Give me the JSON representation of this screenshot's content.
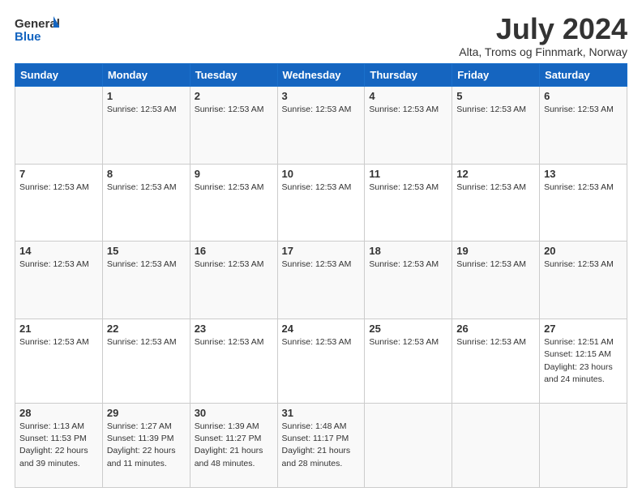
{
  "header": {
    "logo_line1": "General",
    "logo_line2": "Blue",
    "month_title": "July 2024",
    "location": "Alta, Troms og Finnmark, Norway"
  },
  "days_of_week": [
    "Sunday",
    "Monday",
    "Tuesday",
    "Wednesday",
    "Thursday",
    "Friday",
    "Saturday"
  ],
  "weeks": [
    [
      {
        "day": "",
        "info": ""
      },
      {
        "day": "1",
        "info": "Sunrise: 12:53 AM"
      },
      {
        "day": "2",
        "info": "Sunrise: 12:53 AM"
      },
      {
        "day": "3",
        "info": "Sunrise: 12:53 AM"
      },
      {
        "day": "4",
        "info": "Sunrise: 12:53 AM"
      },
      {
        "day": "5",
        "info": "Sunrise: 12:53 AM"
      },
      {
        "day": "6",
        "info": "Sunrise: 12:53 AM"
      }
    ],
    [
      {
        "day": "7",
        "info": "Sunrise: 12:53 AM"
      },
      {
        "day": "8",
        "info": "Sunrise: 12:53 AM"
      },
      {
        "day": "9",
        "info": "Sunrise: 12:53 AM"
      },
      {
        "day": "10",
        "info": "Sunrise: 12:53 AM"
      },
      {
        "day": "11",
        "info": "Sunrise: 12:53 AM"
      },
      {
        "day": "12",
        "info": "Sunrise: 12:53 AM"
      },
      {
        "day": "13",
        "info": "Sunrise: 12:53 AM"
      }
    ],
    [
      {
        "day": "14",
        "info": "Sunrise: 12:53 AM"
      },
      {
        "day": "15",
        "info": "Sunrise: 12:53 AM"
      },
      {
        "day": "16",
        "info": "Sunrise: 12:53 AM"
      },
      {
        "day": "17",
        "info": "Sunrise: 12:53 AM"
      },
      {
        "day": "18",
        "info": "Sunrise: 12:53 AM"
      },
      {
        "day": "19",
        "info": "Sunrise: 12:53 AM"
      },
      {
        "day": "20",
        "info": "Sunrise: 12:53 AM"
      }
    ],
    [
      {
        "day": "21",
        "info": "Sunrise: 12:53 AM"
      },
      {
        "day": "22",
        "info": "Sunrise: 12:53 AM"
      },
      {
        "day": "23",
        "info": "Sunrise: 12:53 AM"
      },
      {
        "day": "24",
        "info": "Sunrise: 12:53 AM"
      },
      {
        "day": "25",
        "info": "Sunrise: 12:53 AM"
      },
      {
        "day": "26",
        "info": "Sunrise: 12:53 AM"
      },
      {
        "day": "27",
        "info": "Sunrise: 12:51 AM\nSunset: 12:15 AM\nDaylight: 23 hours and 24 minutes."
      }
    ],
    [
      {
        "day": "28",
        "info": "Sunrise: 1:13 AM\nSunset: 11:53 PM\nDaylight: 22 hours and 39 minutes."
      },
      {
        "day": "29",
        "info": "Sunrise: 1:27 AM\nSunset: 11:39 PM\nDaylight: 22 hours and 11 minutes."
      },
      {
        "day": "30",
        "info": "Sunrise: 1:39 AM\nSunset: 11:27 PM\nDaylight: 21 hours and 48 minutes."
      },
      {
        "day": "31",
        "info": "Sunrise: 1:48 AM\nSunset: 11:17 PM\nDaylight: 21 hours and 28 minutes."
      },
      {
        "day": "",
        "info": ""
      },
      {
        "day": "",
        "info": ""
      },
      {
        "day": "",
        "info": ""
      }
    ]
  ]
}
